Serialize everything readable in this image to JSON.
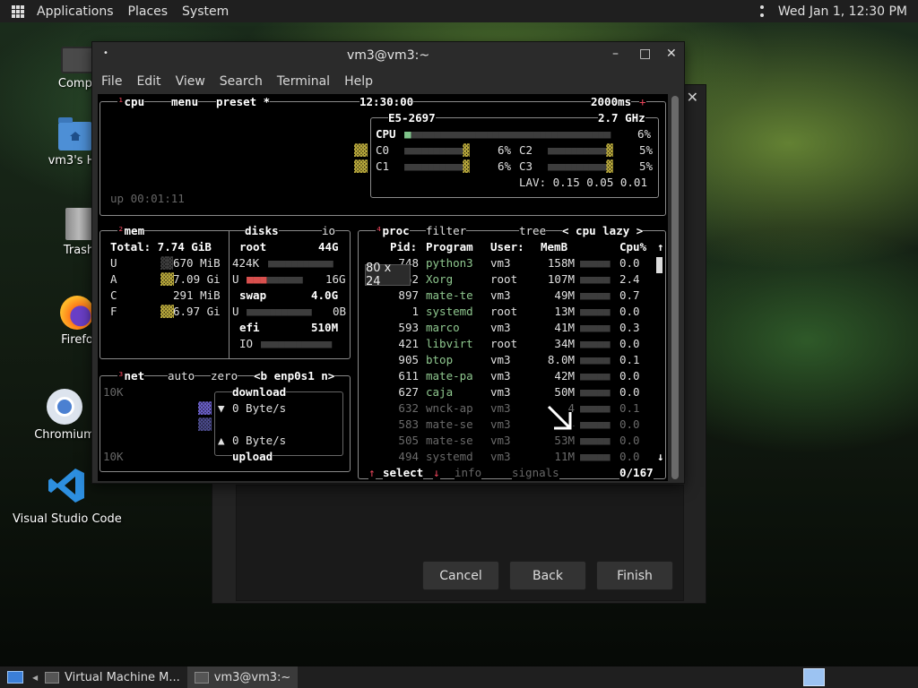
{
  "top_panel": {
    "applications": "Applications",
    "places": "Places",
    "system": "System",
    "clock": "Wed Jan 1, 12:30 PM"
  },
  "desktop_icons": {
    "computer": "Compu",
    "home": "vm3's Ho",
    "trash": "Trash",
    "firefox": "Firefo",
    "chromium": "Chromium",
    "vscode": "Visual Studio Code"
  },
  "background_dialog": {
    "cancel": "Cancel",
    "back": "Back",
    "finish": "Finish"
  },
  "terminal": {
    "title": "vm3@vm3:~",
    "menu": [
      "File",
      "Edit",
      "View",
      "Search",
      "Terminal",
      "Help"
    ],
    "size_tooltip": "80 x 24"
  },
  "btop": {
    "cpu_box": {
      "num": "¹",
      "tab_cpu": "cpu",
      "tab_menu": "menu",
      "tab_preset": "preset *",
      "clock": "12:30:00",
      "interval": "2000ms",
      "model": "E5-2697",
      "freq": "2.7 GHz",
      "total_label": "CPU",
      "total_pct": "6%",
      "cores": [
        {
          "name": "C0",
          "pct": "6%"
        },
        {
          "name": "C1",
          "pct": "6%"
        },
        {
          "name": "C2",
          "pct": "5%"
        },
        {
          "name": "C3",
          "pct": "5%"
        }
      ],
      "lav": "LAV: 0.15 0.05 0.01",
      "uptime": "up 00:01:11"
    },
    "mem_box": {
      "num": "²",
      "title": "mem",
      "total": "Total: 7.74 GiB",
      "rows": [
        {
          "k": "U",
          "v": "670 MiB"
        },
        {
          "k": "A",
          "v": "7.09 Gi"
        },
        {
          "k": "C",
          "v": "291 MiB"
        },
        {
          "k": "F",
          "v": "6.97 Gi"
        }
      ]
    },
    "disks_box": {
      "title": "disks",
      "io": "io",
      "root": "root",
      "root_size": "44G",
      "root_io": "424K",
      "root_used": "16G",
      "swap": "swap",
      "swap_size": "4.0G",
      "swap_used": "0B",
      "efi": "efi",
      "efi_size": "510M",
      "efi_io": "IO"
    },
    "net_box": {
      "num": "³",
      "title": "net",
      "auto": "auto",
      "zero": "zero",
      "iface": "<b enp0s1 n>",
      "scale_top": "10K",
      "scale_bottom": "10K",
      "download": "download",
      "download_rate": "0 Byte/s",
      "upload_rate": "0 Byte/s",
      "upload": "upload"
    },
    "proc_box": {
      "num": "⁴",
      "title": "proc",
      "filter": "filter",
      "tree": "tree",
      "sort": "< cpu lazy >",
      "headers": {
        "pid": "Pid:",
        "program": "Program",
        "user": "User:",
        "mem": "MemB",
        "cpu": "Cpu%"
      },
      "rows": [
        {
          "pid": "748",
          "program": "python3",
          "user": "vm3",
          "mem": "158M",
          "cpu": "0.0"
        },
        {
          "pid": "752",
          "program": "Xorg",
          "user": "root",
          "mem": "107M",
          "cpu": "2.4"
        },
        {
          "pid": "897",
          "program": "mate-te",
          "user": "vm3",
          "mem": "49M",
          "cpu": "0.7"
        },
        {
          "pid": "1",
          "program": "systemd",
          "user": "root",
          "mem": "13M",
          "cpu": "0.0"
        },
        {
          "pid": "593",
          "program": "marco",
          "user": "vm3",
          "mem": "41M",
          "cpu": "0.3"
        },
        {
          "pid": "421",
          "program": "libvirt",
          "user": "root",
          "mem": "34M",
          "cpu": "0.0"
        },
        {
          "pid": "905",
          "program": "btop",
          "user": "vm3",
          "mem": "8.0M",
          "cpu": "0.1"
        },
        {
          "pid": "611",
          "program": "mate-pa",
          "user": "vm3",
          "mem": "42M",
          "cpu": "0.0"
        },
        {
          "pid": "627",
          "program": "caja",
          "user": "vm3",
          "mem": "50M",
          "cpu": "0.0"
        },
        {
          "pid": "632",
          "program": "wnck-ap",
          "user": "vm3",
          "mem": "4",
          "cpu": "0.1"
        },
        {
          "pid": "583",
          "program": "mate-se",
          "user": "vm3",
          "mem": "4",
          "cpu": "0.0"
        },
        {
          "pid": "505",
          "program": "mate-se",
          "user": "vm3",
          "mem": "53M",
          "cpu": "0.0"
        },
        {
          "pid": "494",
          "program": "systemd",
          "user": "vm3",
          "mem": "11M",
          "cpu": "0.0"
        }
      ],
      "select": "select",
      "info": "info",
      "signals": "signals",
      "count": "0/167"
    }
  },
  "taskbar": {
    "vmm": "Virtual Machine M...",
    "terminal": "vm3@vm3:~"
  }
}
